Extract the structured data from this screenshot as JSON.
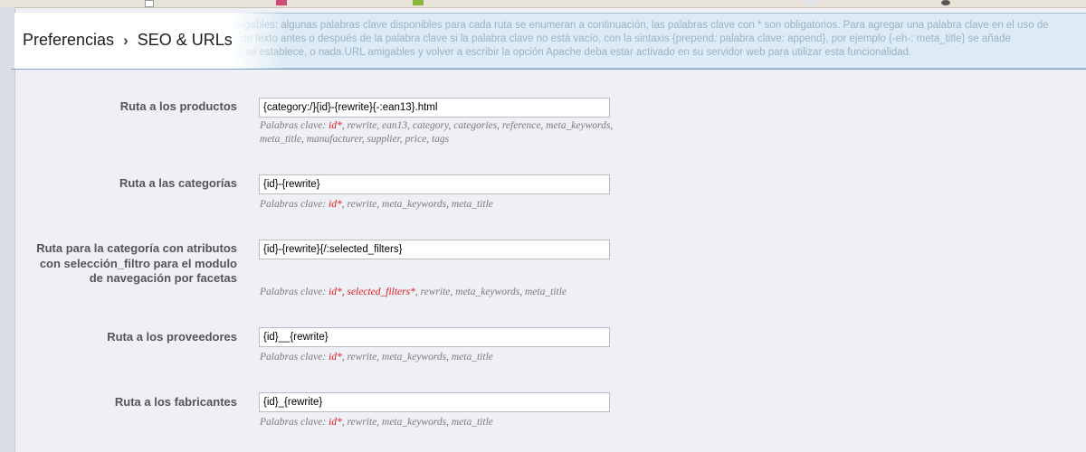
{
  "breadcrumb": {
    "parent": "Preferencias",
    "current": "SEO & URLs"
  },
  "banner": {
    "line1": "Cambie el patrón de las URL amigables: algunas palabras clave disponibles para cada ruta se enumeran a continuación, las palabras clave con * son obligatorios. Para agregar una palabra clave en el uso de",
    "line2": "la URL, y puede añadir un poco de texto antes o después de la palabra clave si la palabra clave no está vacío, con la sintaxis {prepend: palabra clave: append}, por ejemplo {-eh-: meta_title} se añade",
    "line3": "título\" en la URL, si meta el título se establece, o nada.URL amigables y volver a escribir la opción Apache deba estar activado en su servidor web para utilizar esta funcionalidad."
  },
  "hint_prefix": "Palabras clave:",
  "routes": [
    {
      "label_lines": [
        "Ruta a los productos"
      ],
      "value": "{category:/}{id}-{rewrite}{-:ean13}.html",
      "required": [
        "id*"
      ],
      "hint_rest_line1": ", rewrite, ean13, category, categories, reference, meta_keywords,",
      "hint_rest_line2": "meta_title, manufacturer, supplier, price, tags"
    },
    {
      "label_lines": [
        "Ruta a las categorías"
      ],
      "value": "{id}-{rewrite}",
      "required": [
        "id*"
      ],
      "hint_rest_line1": ", rewrite, meta_keywords, meta_title"
    },
    {
      "label_lines": [
        "Ruta para la categoría con atributos",
        "con selección_filtro para el modulo",
        "de navegación por facetas"
      ],
      "value": "{id}-{rewrite}{/:selected_filters}",
      "required": [
        "id*",
        "selected_filters*"
      ],
      "hint_rest_line1": ", rewrite, meta_keywords, meta_title"
    },
    {
      "label_lines": [
        "Ruta a los proveedores"
      ],
      "value": "{id}__{rewrite}",
      "required": [
        "id*"
      ],
      "hint_rest_line1": ", rewrite, meta_keywords, meta_title"
    },
    {
      "label_lines": [
        "Ruta a los fabricantes"
      ],
      "value": "{id}_{rewrite}",
      "required": [
        "id*"
      ],
      "hint_rest_line1": ", rewrite, meta_keywords, meta_title"
    }
  ],
  "colors": {
    "required": "#e01a1a",
    "banner_bg": "#dcebf5",
    "page_bg": "#eef0f5"
  }
}
